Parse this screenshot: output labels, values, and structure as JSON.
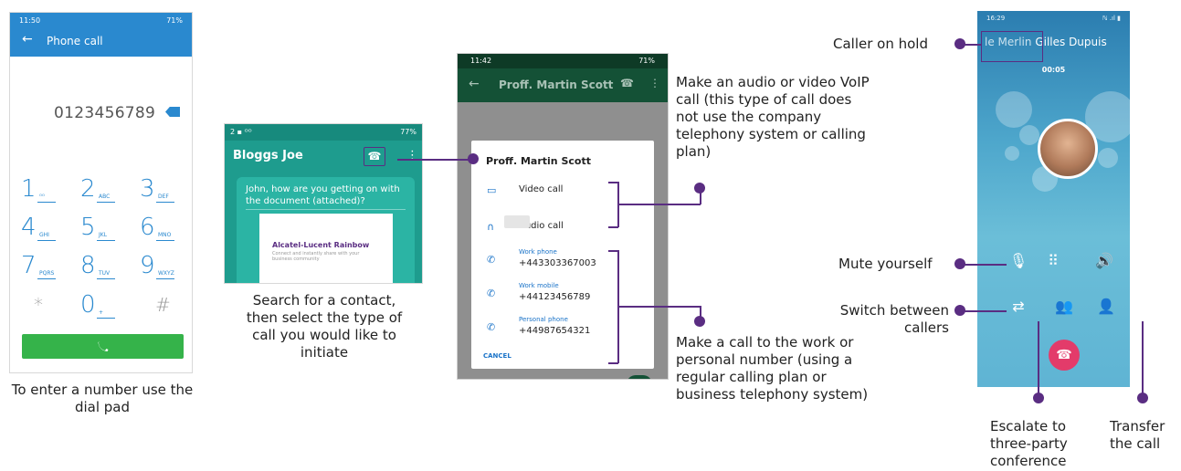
{
  "phone1": {
    "status": {
      "time": "11:50",
      "battery": "71%"
    },
    "title": "Phone call",
    "number": "0123456789",
    "keys": [
      {
        "digit": "1",
        "letters": ""
      },
      {
        "digit": "2",
        "letters": "ABC"
      },
      {
        "digit": "3",
        "letters": "DEF"
      },
      {
        "digit": "4",
        "letters": "GHI"
      },
      {
        "digit": "5",
        "letters": "JKL"
      },
      {
        "digit": "6",
        "letters": "MNO"
      },
      {
        "digit": "7",
        "letters": "PQRS"
      },
      {
        "digit": "8",
        "letters": "TUV"
      },
      {
        "digit": "9",
        "letters": "WXYZ"
      },
      {
        "digit": "*",
        "letters": ""
      },
      {
        "digit": "0",
        "letters": "+"
      },
      {
        "digit": "#",
        "letters": ""
      }
    ],
    "caption": "To enter a number use the dial pad"
  },
  "phone2": {
    "status": {
      "battery": "77%"
    },
    "contact": "Bloggs Joe",
    "message": "John, how are you getting on with the document (attached)?",
    "doc_title": "Alcatel-Lucent Rainbow",
    "doc_sub": "Connect and instantly share with your business community",
    "caption": "Search for a contact, then select the type of call you would like to initiate"
  },
  "phone3": {
    "status": {
      "time": "11:42",
      "battery": "71%"
    },
    "toolbar_title": "Proff. Martin Scott",
    "dialog_title": "Proff. Martin Scott",
    "video_call": "Video call",
    "audio_call": "Audio call",
    "work_phone_label": "Work phone",
    "work_phone": "+443303367003",
    "work_mobile_label": "Work mobile",
    "work_mobile": "+44123456789",
    "personal_phone_label": "Personal phone",
    "personal_phone": "+44987654321",
    "cancel": "CANCEL"
  },
  "phone4": {
    "status": {
      "time": "16:29"
    },
    "held_name": "le Merlin",
    "active_name": "Gilles Dupuis",
    "timer": "00:05"
  },
  "notes": {
    "voip": "Make an audio or video VoIP call (this type of call does not use the company telephony system or calling plan)",
    "regular": "Make a call to the work or personal number (using a regular calling plan or business telephony system)",
    "hold": "Caller on hold",
    "mute": "Mute yourself",
    "switch": "Switch between callers",
    "escalate": "Escalate to three-party conference",
    "transfer": "Transfer the call"
  },
  "colors": {
    "accent": "#5a2d82",
    "dialer_blue": "#2a89cf",
    "call_green": "#35b34a",
    "teal": "#1e9c8e",
    "end_call": "#e33b6a"
  }
}
